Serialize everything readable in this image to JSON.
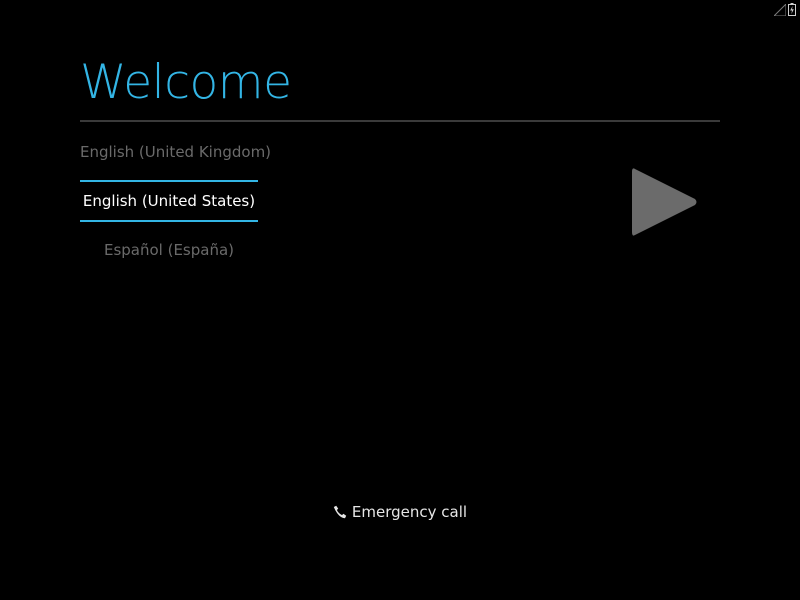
{
  "status_bar": {
    "icons": [
      "signal-icon",
      "battery-charging-icon"
    ]
  },
  "welcome": {
    "title": "Welcome"
  },
  "language_picker": {
    "items": [
      {
        "label": "English (United Kingdom)",
        "selected": false
      },
      {
        "label": "English (United States)",
        "selected": true
      },
      {
        "label": "Español (España)",
        "selected": false
      }
    ]
  },
  "next_button": {
    "icon": "play-arrow-icon"
  },
  "emergency": {
    "label": "Emergency call",
    "icon": "phone-icon"
  },
  "colors": {
    "background": "#000000",
    "accent": "#33b5e5",
    "title": "#33b5e5",
    "text_primary": "#ffffff",
    "text_dim": "#6a6a6a",
    "divider": "#3a3a3a",
    "arrow": "#6b6b6b",
    "emergency_text": "#e6e6e6"
  }
}
